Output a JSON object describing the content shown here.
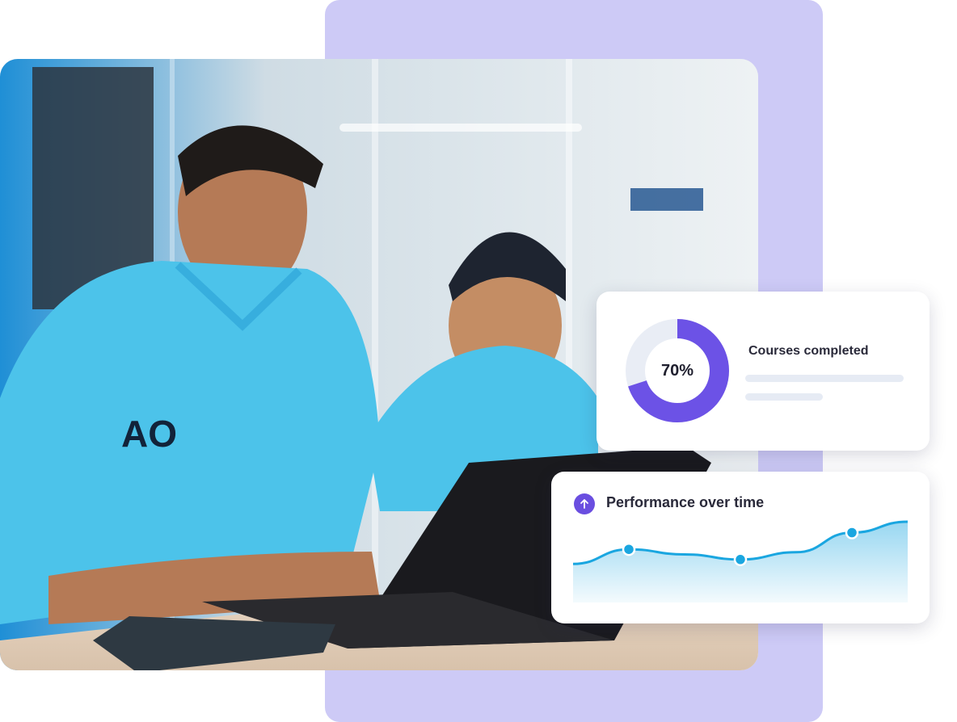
{
  "courses_card": {
    "title": "Courses completed",
    "percent_label": "70%",
    "progress_fraction": 0.7,
    "ring_color": "#6c52e6",
    "track_color": "#e9edf5"
  },
  "performance_card": {
    "title": "Performance over time",
    "icon": "arrow-up-icon",
    "accent_color": "#1aa6e0",
    "icon_color": "#6a4ee0",
    "trend_values": [
      0.42,
      0.62,
      0.55,
      0.48,
      0.58,
      0.85,
      1.0
    ],
    "marker_points": [
      1,
      3,
      5
    ]
  },
  "photo": {
    "shirt_logo": "AO"
  }
}
